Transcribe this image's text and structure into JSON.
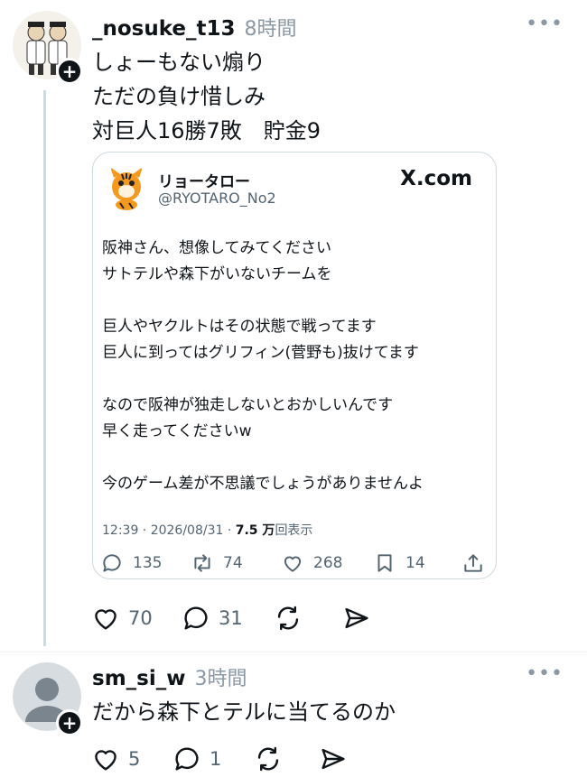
{
  "post1": {
    "username": "_nosuke_t13",
    "time": "8時間",
    "more": "•••",
    "follow": "+",
    "body": "しょーもない煽り\nただの負け惜しみ\n対巨人16勝7敗　貯金9",
    "quote": {
      "name": "リョータロー",
      "handle": "@RYOTARO_No2",
      "source": "X.com",
      "text": "阪神さん、想像してみてください\nサトテルや森下がいないチームを\n\n巨人やヤクルトはその状態で戦ってます\n巨人に到ってはグリフィン(菅野も)抜けてます\n\nなので阪神が独走しないとおかしいんです\n早く走ってくださいw\n\n今のゲーム差が不思議でしょうがありませんよ",
      "timestamp": "12:39 · 2026/08/31 · ",
      "views": "7.5 万",
      "views_label": "回表示",
      "replies": "135",
      "reposts": "74",
      "likes": "268",
      "bookmarks": "14"
    },
    "likes": "70",
    "replies": "31"
  },
  "post2": {
    "username": "sm_si_w",
    "time": "3時間",
    "more": "•••",
    "follow": "+",
    "body": "だから森下とテルに当てるのか",
    "likes": "5",
    "replies": "1"
  },
  "colors": {
    "text": "#0f1419",
    "muted": "#536471",
    "border": "#cfd9de"
  }
}
